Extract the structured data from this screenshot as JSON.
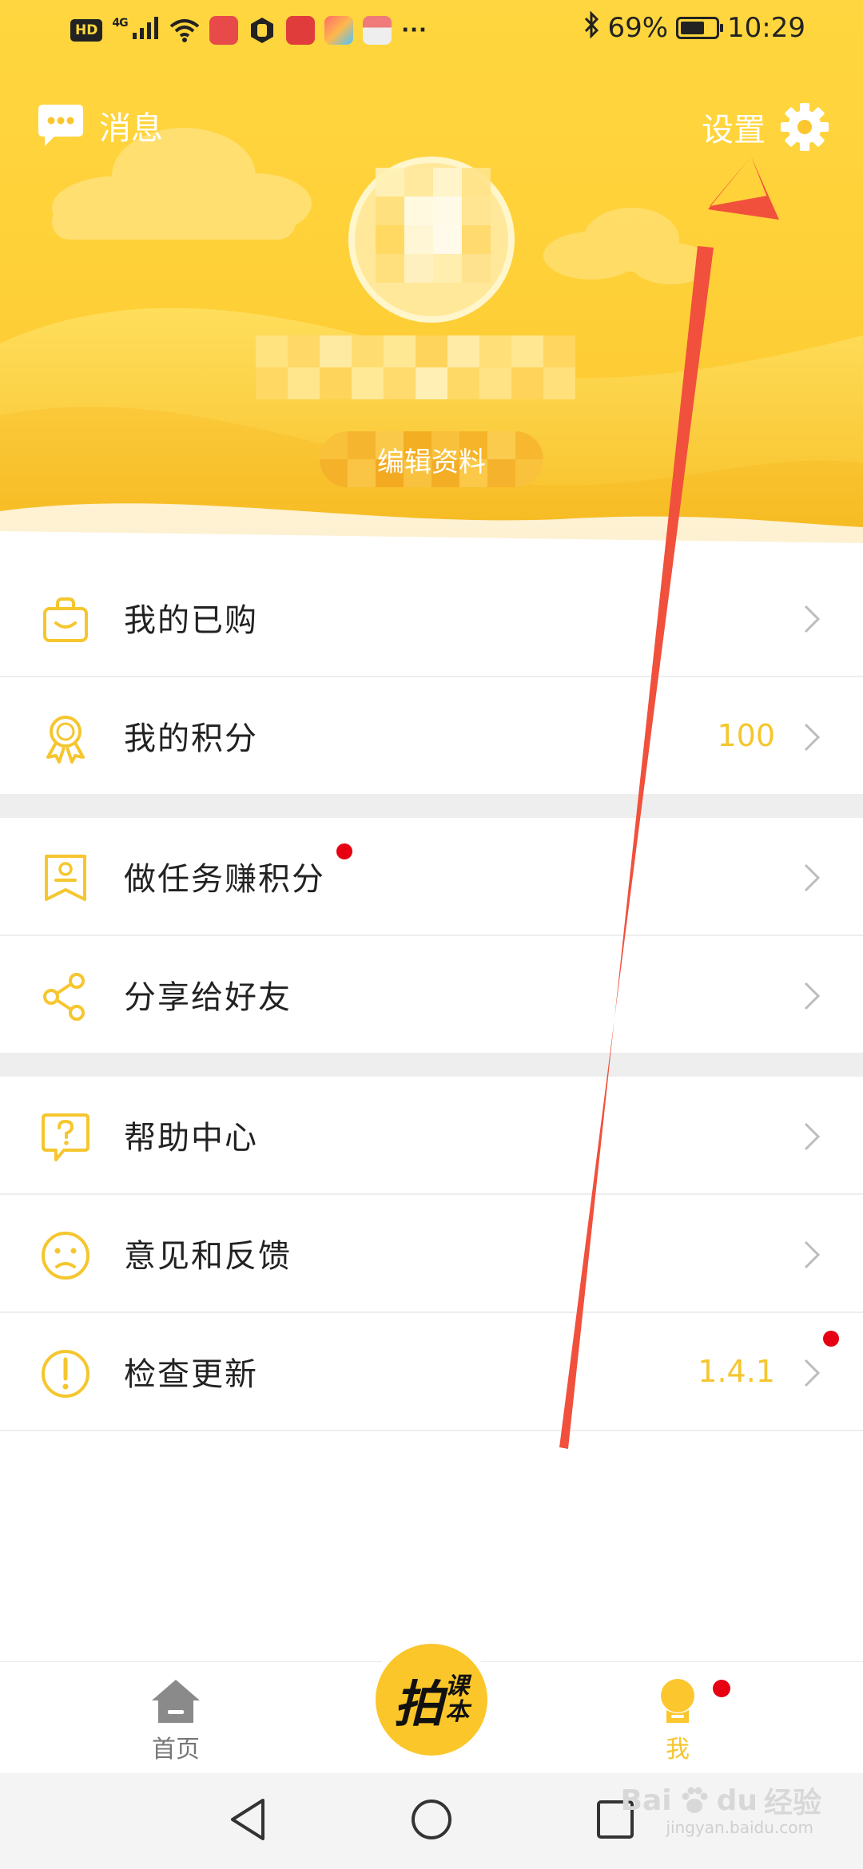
{
  "status_bar": {
    "hd": "HD",
    "signal": "4G",
    "more": "···",
    "battery_text": "69%",
    "battery_level": 0.69,
    "time": "10:29"
  },
  "header": {
    "messages_label": "消息",
    "settings_label": "设置",
    "edit_profile_label": "编辑资料",
    "accent_color": "#FFD63F"
  },
  "menu": {
    "purchased": {
      "label": "我的已购",
      "icon": "shopping-bag-icon"
    },
    "points": {
      "label": "我的积分",
      "value": "100",
      "icon": "medal-icon"
    },
    "tasks": {
      "label": "做任务赚积分",
      "icon": "bookmark-icon",
      "badge": true
    },
    "share": {
      "label": "分享给好友",
      "icon": "share-icon"
    },
    "help": {
      "label": "帮助中心",
      "icon": "help-bubble-icon"
    },
    "feedback": {
      "label": "意见和反馈",
      "icon": "sad-face-icon"
    },
    "update": {
      "label": "检查更新",
      "value": "1.4.1",
      "icon": "alert-circle-icon",
      "badge": true
    }
  },
  "tabbar": {
    "home_label": "首页",
    "center_logo_main": "拍",
    "center_logo_top": "课",
    "center_logo_bottom": "本",
    "me_label": "我",
    "active_color": "#F5C62E"
  },
  "watermark": {
    "brand": "Bai",
    "brand2": "du",
    "cn": "经验",
    "url": "jingyan.baidu.com"
  },
  "annotation_color": "#F0503C"
}
